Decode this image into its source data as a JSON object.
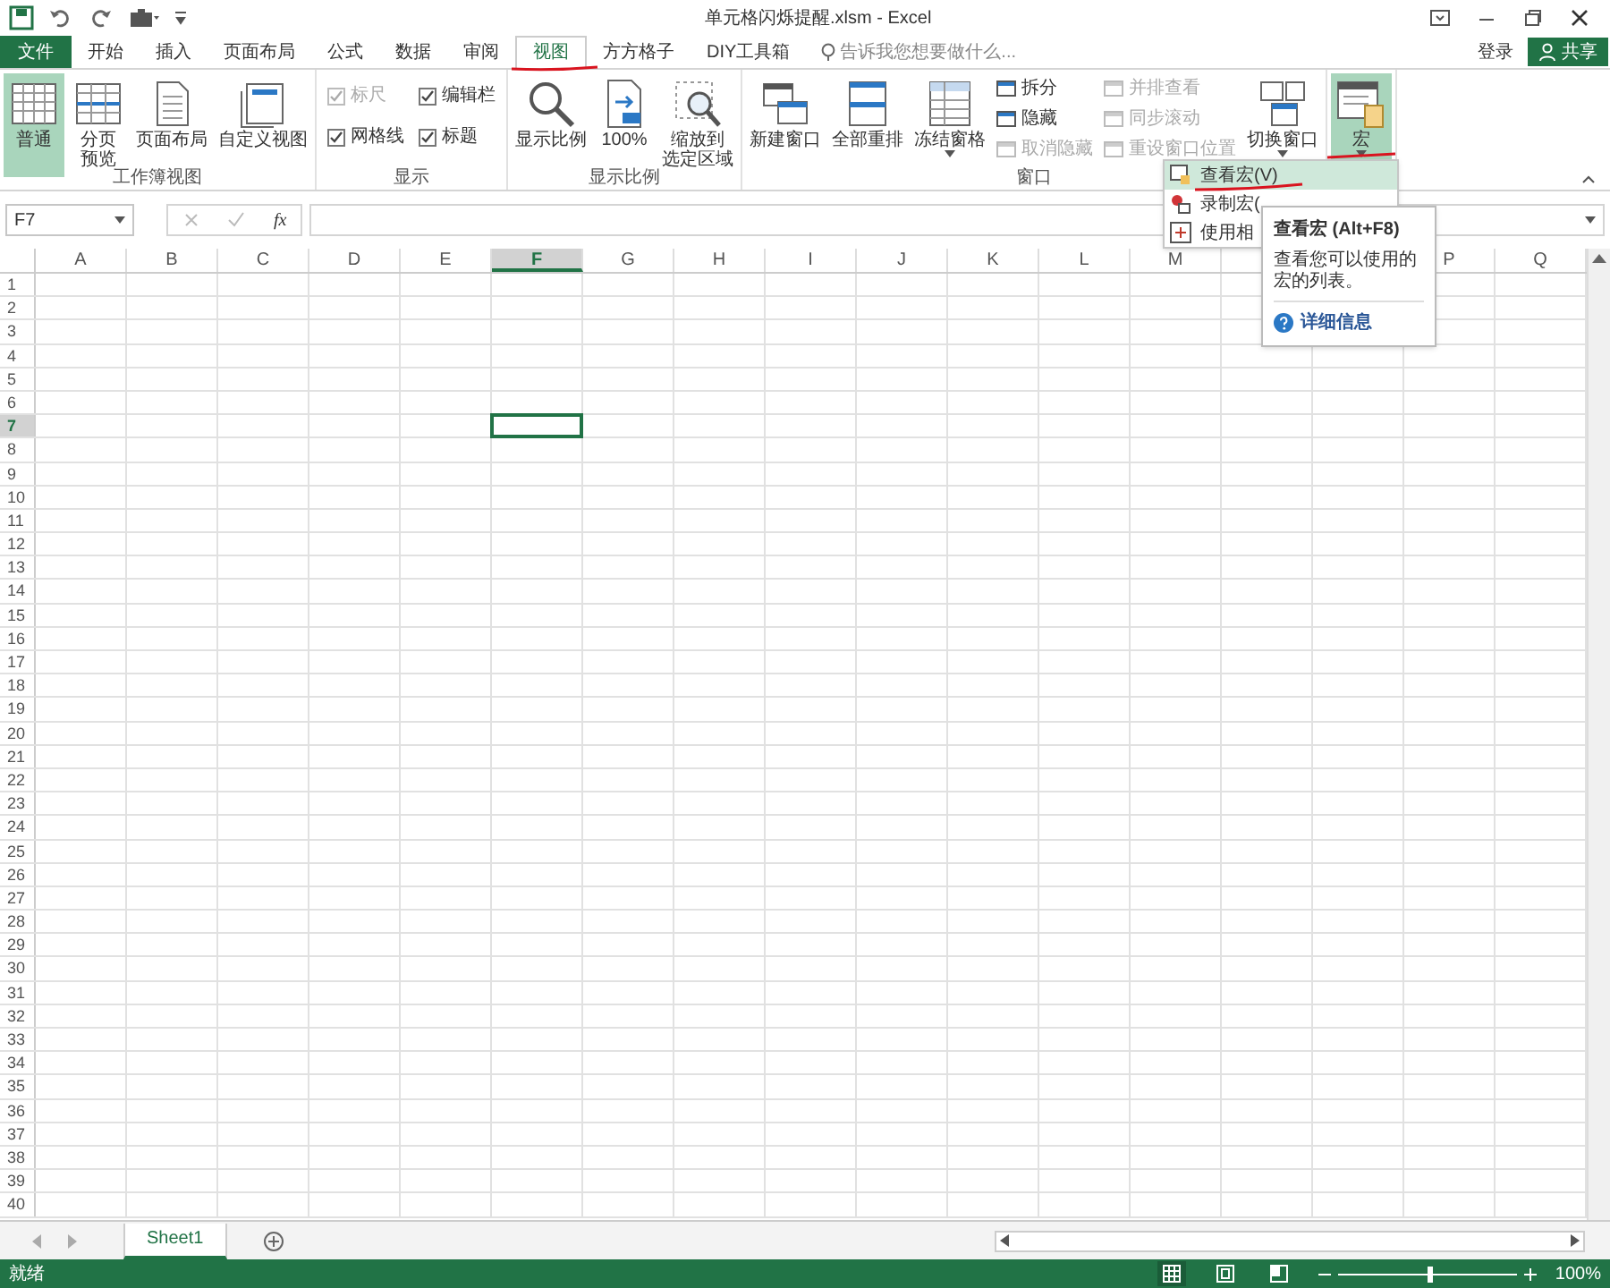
{
  "title_bar": {
    "title": "单元格闪烁提醒.xlsm - Excel"
  },
  "tabs": [
    {
      "label": "文件",
      "kind": "file",
      "selected": false
    },
    {
      "label": "开始",
      "kind": "tab",
      "selected": false
    },
    {
      "label": "插入",
      "kind": "tab",
      "selected": false
    },
    {
      "label": "页面布局",
      "kind": "tab",
      "selected": false
    },
    {
      "label": "公式",
      "kind": "tab",
      "selected": false
    },
    {
      "label": "数据",
      "kind": "tab",
      "selected": false
    },
    {
      "label": "审阅",
      "kind": "tab",
      "selected": false
    },
    {
      "label": "视图",
      "kind": "tab",
      "selected": true
    },
    {
      "label": "方方格子",
      "kind": "tab",
      "selected": false
    },
    {
      "label": "DIY工具箱",
      "kind": "tab",
      "selected": false
    }
  ],
  "tell_me": {
    "placeholder": "告诉我您想要做什么..."
  },
  "account": {
    "sign_in": "登录",
    "share": "共享"
  },
  "ribbon": {
    "groups": [
      {
        "label": "工作簿视图",
        "items": [
          {
            "kind": "large",
            "label": "普通",
            "selected": true
          },
          {
            "kind": "large",
            "label_lines": [
              "分页",
              "预览"
            ],
            "selected": false
          },
          {
            "kind": "large",
            "label": "页面布局",
            "selected": false
          },
          {
            "kind": "large",
            "label": "自定义视图",
            "selected": false
          }
        ]
      },
      {
        "label": "显示",
        "items": [
          {
            "kind": "checks",
            "items": [
              {
                "label": "标尺",
                "checked": true,
                "disabled": true
              },
              {
                "label": "编辑栏",
                "checked": true,
                "disabled": false
              },
              {
                "label": "网格线",
                "checked": true,
                "disabled": false
              },
              {
                "label": "标题",
                "checked": true,
                "disabled": false
              }
            ]
          }
        ]
      },
      {
        "label": "显示比例",
        "items": [
          {
            "kind": "large",
            "label": "显示比例",
            "selected": false
          },
          {
            "kind": "large",
            "label": "100%",
            "selected": false
          },
          {
            "kind": "large",
            "label_lines": [
              "缩放到",
              "选定区域"
            ],
            "selected": false
          }
        ]
      },
      {
        "label": "窗口",
        "items": [
          {
            "kind": "large",
            "label": "新建窗口",
            "selected": false
          },
          {
            "kind": "large",
            "label": "全部重排",
            "selected": false
          },
          {
            "kind": "large",
            "label": "冻结窗格",
            "selected": false,
            "dropdown": true
          },
          {
            "kind": "stack",
            "items": [
              {
                "label": "拆分",
                "disabled": false
              },
              {
                "label": "隐藏",
                "disabled": false
              },
              {
                "label": "取消隐藏",
                "disabled": true
              }
            ]
          },
          {
            "kind": "stack",
            "items": [
              {
                "label": "并排查看",
                "disabled": true
              },
              {
                "label": "同步滚动",
                "disabled": true
              },
              {
                "label": "重设窗口位置",
                "disabled": true
              }
            ]
          },
          {
            "kind": "large",
            "label": "切换窗口",
            "selected": false,
            "dropdown": true
          }
        ]
      },
      {
        "items": [
          {
            "kind": "large",
            "label": "宏",
            "selected": true,
            "dropdown": true
          }
        ]
      }
    ]
  },
  "formula_bar": {
    "name_box": "F7",
    "function_label": "fx"
  },
  "sheet": {
    "columns": [
      {
        "label": "A",
        "selected": false
      },
      {
        "label": "B",
        "selected": false
      },
      {
        "label": "C",
        "selected": false
      },
      {
        "label": "D",
        "selected": false
      },
      {
        "label": "E",
        "selected": false
      },
      {
        "label": "F",
        "selected": true
      },
      {
        "label": "G",
        "selected": false
      },
      {
        "label": "H",
        "selected": false
      },
      {
        "label": "I",
        "selected": false
      },
      {
        "label": "J",
        "selected": false
      },
      {
        "label": "K",
        "selected": false
      },
      {
        "label": "L",
        "selected": false
      },
      {
        "label": "M",
        "selected": false
      },
      {},
      {},
      {
        "label": "P",
        "selected": false
      },
      {
        "label": "Q",
        "selected": false
      }
    ],
    "rows": [
      {
        "label": "1",
        "selected": false
      },
      {
        "label": "2",
        "selected": false
      },
      {
        "label": "3",
        "selected": false
      },
      {
        "label": "4",
        "selected": false
      },
      {
        "label": "5",
        "selected": false
      },
      {
        "label": "6",
        "selected": false
      },
      {
        "label": "7",
        "selected": true
      },
      {
        "label": "8",
        "selected": false
      },
      {
        "label": "9",
        "selected": false
      },
      {
        "label": "10",
        "selected": false
      },
      {
        "label": "11",
        "selected": false
      },
      {
        "label": "12",
        "selected": false
      },
      {
        "label": "13",
        "selected": false
      },
      {
        "label": "14",
        "selected": false
      },
      {
        "label": "15",
        "selected": false
      },
      {
        "label": "16",
        "selected": false
      },
      {
        "label": "17",
        "selected": false
      },
      {
        "label": "18",
        "selected": false
      },
      {
        "label": "19",
        "selected": false
      },
      {
        "label": "20",
        "selected": false
      },
      {
        "label": "21",
        "selected": false
      },
      {
        "label": "22",
        "selected": false
      },
      {
        "label": "23",
        "selected": false
      },
      {
        "label": "24",
        "selected": false
      },
      {
        "label": "25",
        "selected": false
      },
      {
        "label": "26",
        "selected": false
      },
      {
        "label": "27",
        "selected": false
      },
      {
        "label": "28",
        "selected": false
      },
      {
        "label": "29",
        "selected": false
      },
      {
        "label": "30",
        "selected": false
      },
      {
        "label": "31",
        "selected": false
      },
      {
        "label": "32",
        "selected": false
      },
      {
        "label": "33",
        "selected": false
      },
      {
        "label": "34",
        "selected": false
      },
      {
        "label": "35",
        "selected": false
      },
      {
        "label": "36",
        "selected": false
      },
      {
        "label": "37",
        "selected": false
      },
      {
        "label": "38",
        "selected": false
      },
      {
        "label": "39",
        "selected": false
      },
      {
        "label": "40",
        "selected": false
      }
    ]
  },
  "macro_menu": {
    "items": [
      {
        "label": "查看宏(V)",
        "selected": true
      },
      {
        "label": "录制宏(",
        "selected": false
      },
      {
        "label": "使用相",
        "selected": false
      }
    ]
  },
  "tooltip": {
    "title": "查看宏 (Alt+F8)",
    "body": "查看您可以使用的宏的列表。",
    "link": "详细信息"
  },
  "sheet_tabs": [
    {
      "label": "Sheet1",
      "selected": true
    }
  ],
  "status_bar": {
    "text": "就绪",
    "views": [
      {
        "kind": "normal",
        "selected": true
      },
      {
        "kind": "layout",
        "selected": false
      },
      {
        "kind": "break",
        "selected": false
      }
    ],
    "zoom": {
      "level": 0.5
    },
    "zoom_label": "100%"
  }
}
